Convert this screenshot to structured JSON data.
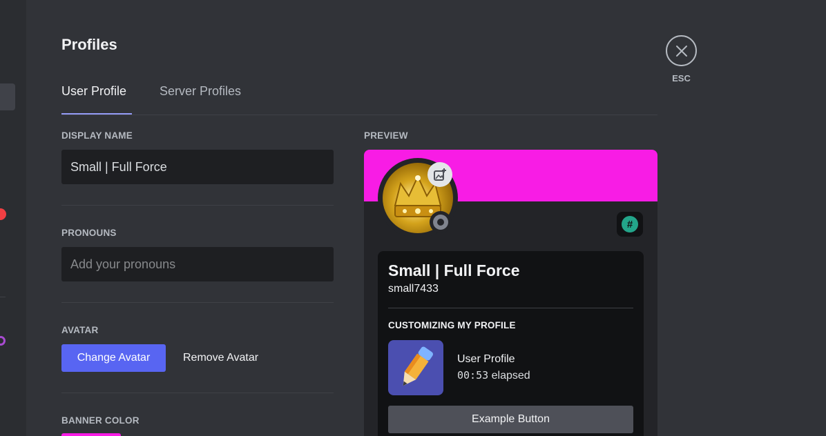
{
  "page": {
    "title": "Profiles"
  },
  "tabs": [
    {
      "label": "User Profile",
      "active": true
    },
    {
      "label": "Server Profiles",
      "active": false
    }
  ],
  "form": {
    "display_name": {
      "label": "DISPLAY NAME",
      "value": "Small | Full Force"
    },
    "pronouns": {
      "label": "PRONOUNS",
      "value": "",
      "placeholder": "Add your pronouns"
    },
    "avatar": {
      "label": "AVATAR",
      "change_label": "Change Avatar",
      "remove_label": "Remove Avatar"
    },
    "banner_color": {
      "label": "BANNER COLOR",
      "value": "#f81ce5"
    }
  },
  "close": {
    "label": "ESC",
    "icon": "close-icon"
  },
  "preview": {
    "label": "PREVIEW",
    "banner_color": "#f81ce5",
    "display_name": "Small | Full Force",
    "username": "small7433",
    "status": "offline",
    "badge_icon": "hashtag-badge-icon",
    "activity": {
      "heading": "CUSTOMIZING MY PROFILE",
      "title": "User Profile",
      "time": "00:53",
      "elapsed_word": "elapsed",
      "icon": "pencil-icon"
    },
    "example_button": "Example Button"
  },
  "colors": {
    "accent": "#5865f2",
    "tab_indicator": "#949cf7",
    "background": "#313338"
  }
}
